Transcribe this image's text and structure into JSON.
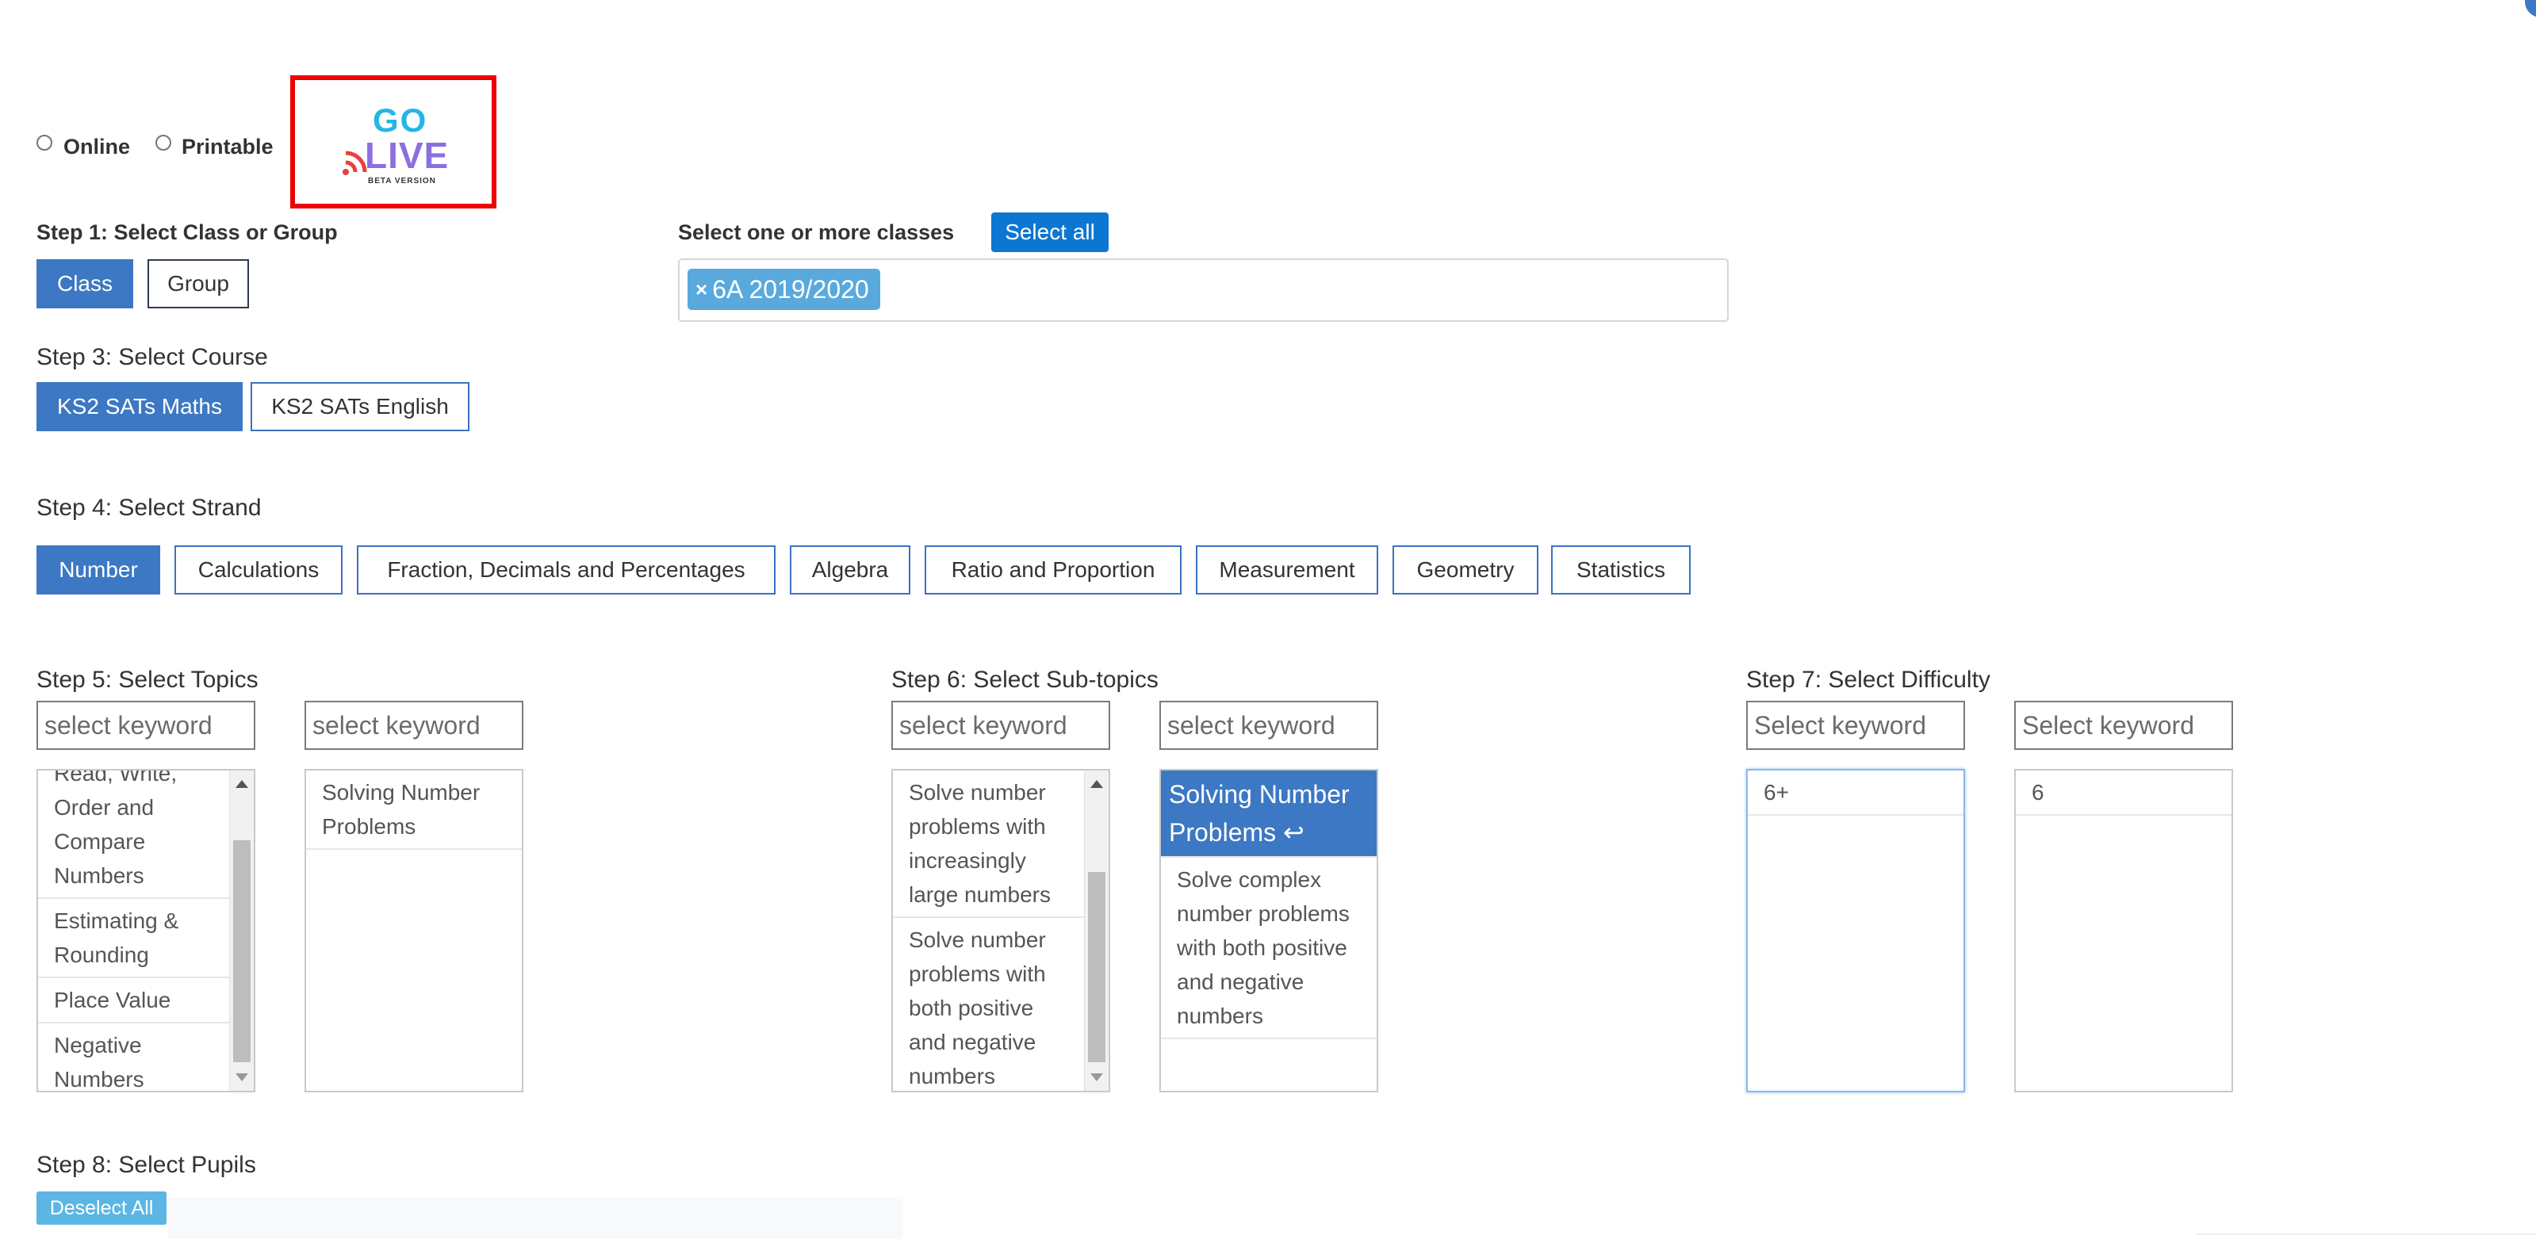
{
  "mode": {
    "online_label": "Online",
    "printable_label": "Printable",
    "golive": {
      "go": "GO",
      "live": "LIVE",
      "beta": "BETA VERSION"
    },
    "selected": "golive"
  },
  "step1": {
    "label": "Step 1: Select Class or Group",
    "buttons": [
      "Class",
      "Group"
    ],
    "active": "Class"
  },
  "classes": {
    "label": "Select one or more classes",
    "select_all": "Select all",
    "chip": "6A 2019/2020",
    "chip_remove": "×"
  },
  "step3": {
    "label": "Step 3: Select Course",
    "buttons": [
      "KS2 SATs Maths",
      "KS2 SATs English"
    ],
    "active": "KS2 SATs Maths"
  },
  "step4": {
    "label": "Step 4: Select Strand",
    "buttons": [
      "Number",
      "Calculations",
      "Fraction, Decimals and Percentages",
      "Algebra",
      "Ratio and Proportion",
      "Measurement",
      "Geometry",
      "Statistics"
    ],
    "active": "Number"
  },
  "step5": {
    "label": "Step 5: Select Topics",
    "kw_left": "select keyword",
    "kw_right": "select keyword",
    "left_items": [
      "Read, Write, Order and Compare Numbers",
      "Estimating & Rounding",
      "Place Value",
      "Negative Numbers"
    ],
    "right_items": [
      "Solving Number Problems"
    ]
  },
  "step6": {
    "label": "Step 6: Select Sub-topics",
    "kw_left": "select keyword",
    "kw_right": "select keyword",
    "left_items": [
      "Solve number problems with increasingly large numbers",
      "Solve number problems with both positive and negative numbers"
    ],
    "right_selected": "Solving Number Problems",
    "right_selected_icon": "↩",
    "right_items": [
      "Solve complex number problems with both positive and negative numbers"
    ]
  },
  "step7": {
    "label": "Step 7: Select Difficulty",
    "kw_left": "Select keyword",
    "kw_right": "Select keyword",
    "left_items": [
      "6+"
    ],
    "right_items": [
      "6"
    ]
  },
  "step8": {
    "label": "Step 8: Select Pupils",
    "deselect_all": "Deselect All"
  },
  "colors": {
    "primary": "#3c78c3",
    "select_all": "#0b77d3",
    "chip": "#5aa9dd",
    "highlight_border": "#ef0000"
  }
}
